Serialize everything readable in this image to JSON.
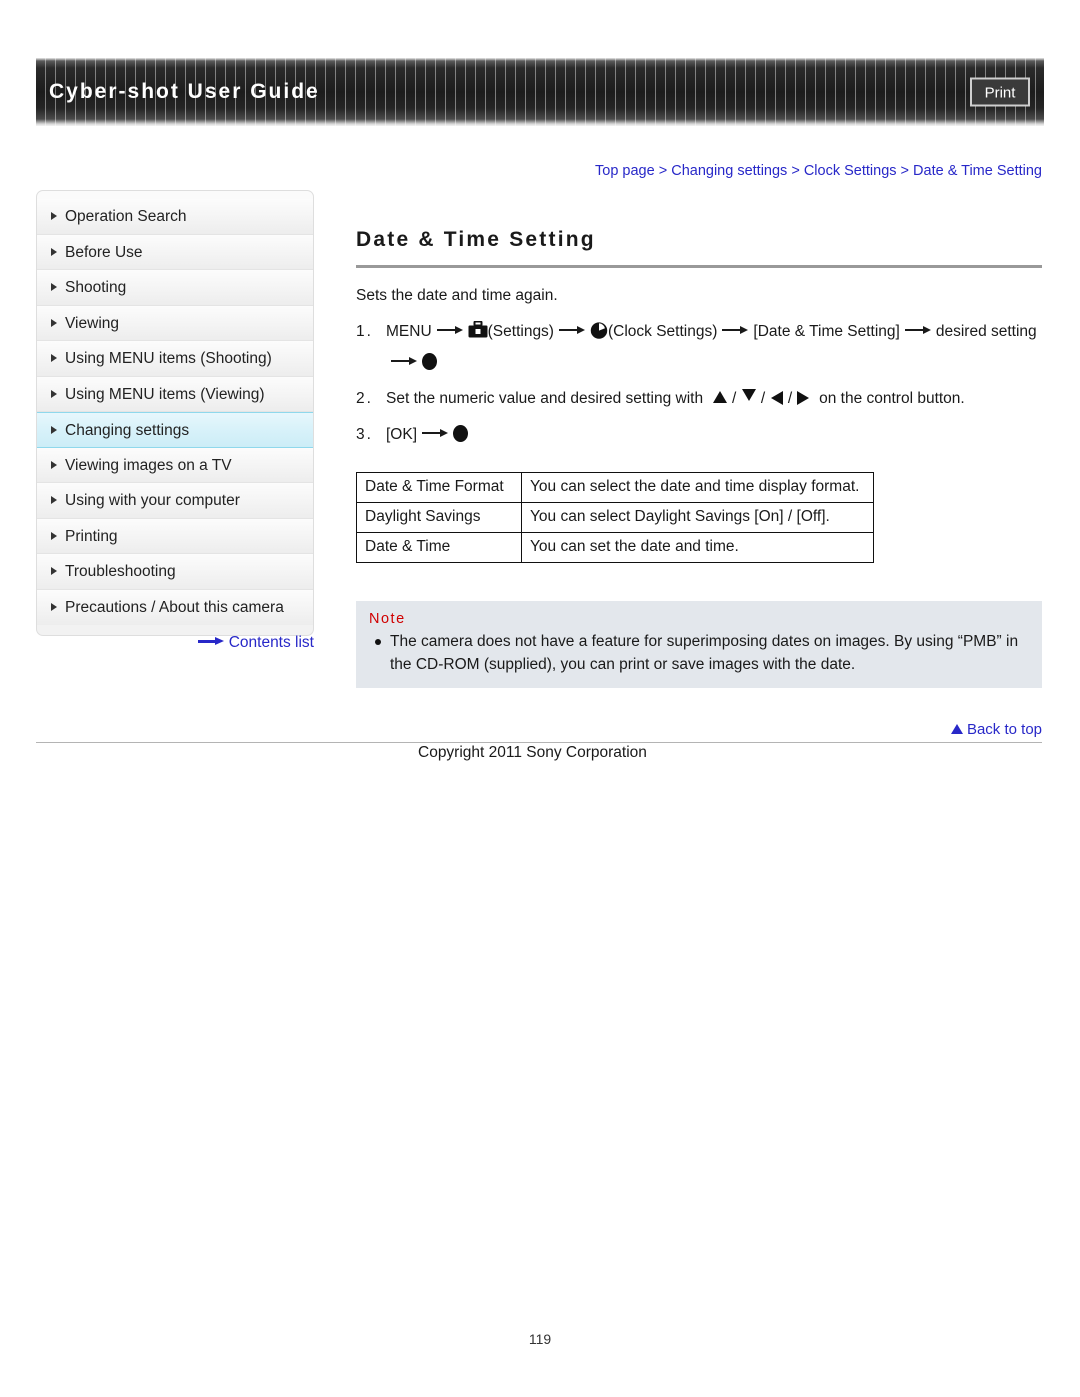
{
  "header": {
    "title": "Cyber-shot User Guide",
    "print_label": "Print"
  },
  "breadcrumb": {
    "separator": ">",
    "items": [
      {
        "label": "Top page"
      },
      {
        "label": "Changing settings"
      },
      {
        "label": "Clock Settings"
      },
      {
        "label": "Date & Time Setting"
      }
    ]
  },
  "sidebar": {
    "items": [
      {
        "label": "Operation Search",
        "active": false
      },
      {
        "label": "Before Use",
        "active": false
      },
      {
        "label": "Shooting",
        "active": false
      },
      {
        "label": "Viewing",
        "active": false
      },
      {
        "label": "Using MENU items (Shooting)",
        "active": false
      },
      {
        "label": "Using MENU items (Viewing)",
        "active": false
      },
      {
        "label": "Changing settings",
        "active": true
      },
      {
        "label": "Viewing images on a TV",
        "active": false
      },
      {
        "label": "Using with your computer",
        "active": false
      },
      {
        "label": "Printing",
        "active": false
      },
      {
        "label": "Troubleshooting",
        "active": false
      },
      {
        "label": "Precautions / About this camera",
        "active": false
      }
    ],
    "contents_list_label": "Contents list"
  },
  "main": {
    "title": "Date & Time Setting",
    "intro": "Sets the date and time again.",
    "steps": [
      {
        "number": "1.",
        "seg1": "MENU",
        "icon1": "toolbox-settings-icon",
        "seg2": "(Settings)",
        "icon2": "clock-settings-icon",
        "seg3": "(Clock Settings)",
        "seg4": "[Date & Time Setting]",
        "seg5": "desired setting",
        "icon3": "center-button-icon"
      },
      {
        "number": "2.",
        "text_before": "Set the numeric value and desired setting with",
        "direction_icons": [
          "up-triangle-icon",
          "down-triangle-icon",
          "left-triangle-icon",
          "right-triangle-icon"
        ],
        "text_after": "on the control button."
      },
      {
        "number": "3.",
        "seg1": "[OK]",
        "icon1": "center-button-icon"
      }
    ],
    "table": {
      "rows": [
        {
          "key": "Date & Time Format",
          "value": "You can select the date and time display format."
        },
        {
          "key": "Daylight Savings",
          "value": "You can select Daylight Savings [On] / [Off]."
        },
        {
          "key": "Date & Time",
          "value": "You can set the date and time."
        }
      ]
    },
    "note": {
      "heading": "Note",
      "items": [
        "The camera does not have a feature for superimposing dates on images. By using “PMB” in the CD-ROM (supplied), you can print or save images with the date."
      ]
    }
  },
  "footer": {
    "back_to_top_label": "Back to top",
    "copyright": "Copyright 2011 Sony Corporation",
    "page_number": "119"
  },
  "colors": {
    "link_blue": "#2828c8",
    "note_red": "#d00000",
    "note_bg": "#e3e7ec",
    "active_sidebar_bg": "#d9f2fa",
    "active_sidebar_border": "#8fd8ec",
    "header_dark": "#1c1c1c"
  }
}
